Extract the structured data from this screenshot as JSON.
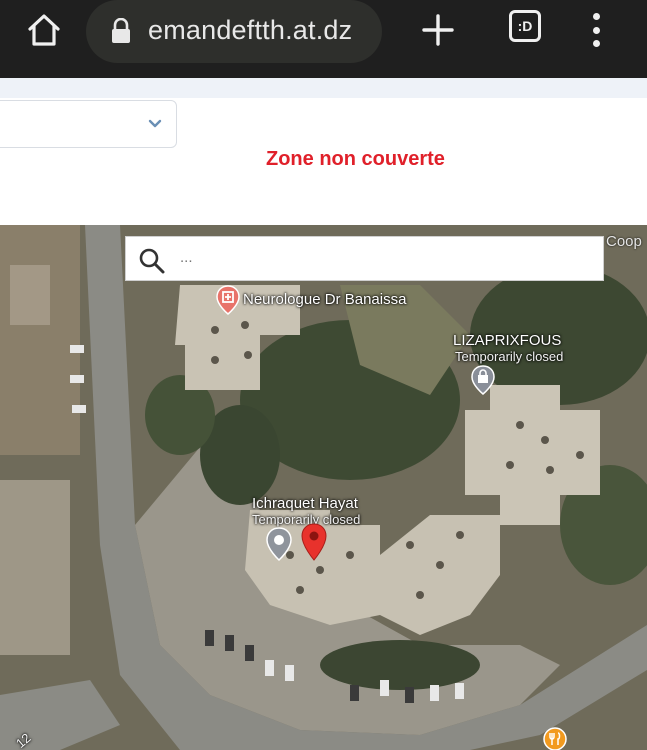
{
  "browser": {
    "url": "emandeftth.at.dz",
    "tab_count_label": ":D"
  },
  "form": {
    "select_value": "",
    "coverage_status": "Zone non couverte",
    "status_color": "#e0202a"
  },
  "map": {
    "search_placeholder": "...",
    "corner_label": "Coop",
    "places": [
      {
        "name": "Neurologue Dr Banaissa",
        "status": "",
        "icon": "hospital-pin-icon"
      },
      {
        "name": "LIZAPRIXFOUS",
        "status": "Temporarily closed",
        "icon": "shopping-bag-pin-icon"
      },
      {
        "name": "Ichraquet Hayat",
        "status": "Temporarily closed",
        "icon": "grey-pin-icon"
      }
    ],
    "selected_marker": "red-location-marker-icon",
    "road_label": "12"
  }
}
